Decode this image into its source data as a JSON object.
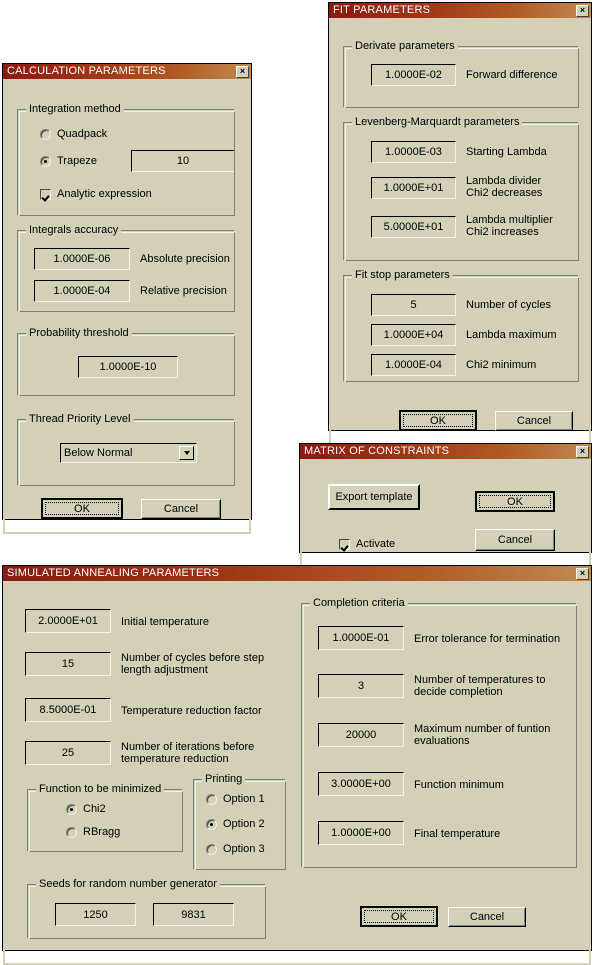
{
  "windows": {
    "calculation": {
      "title": "CALCULATION PARAMETERS",
      "close_label": "×",
      "groups": {
        "integration": {
          "caption": "Integration method",
          "radios": [
            {
              "label": "Quadpack",
              "selected": false
            },
            {
              "label": "Trapeze",
              "selected": true
            }
          ],
          "trapeze_value": "10",
          "checkbox": {
            "label": "Analytic expression",
            "checked": true
          }
        },
        "accuracy": {
          "caption": "Integrals accuracy",
          "rows": [
            {
              "value": "1.0000E-06",
              "label": "Absolute precision"
            },
            {
              "value": "1.0000E-04",
              "label": "Relative precision"
            }
          ]
        },
        "probability": {
          "caption": "Probability threshold",
          "value": "1.0000E-10"
        },
        "thread": {
          "caption": "Thread Priority Level",
          "selected": "Below Normal"
        }
      },
      "buttons": {
        "ok": "OK",
        "cancel": "Cancel"
      }
    },
    "fit": {
      "title": "FIT PARAMETERS",
      "close_label": "×",
      "groups": {
        "derivate": {
          "caption": "Derivate parameters",
          "rows": [
            {
              "value": "1.0000E-02",
              "label": "Forward difference"
            }
          ]
        },
        "levenberg": {
          "caption": "Levenberg-Marquardt parameters",
          "rows": [
            {
              "value": "1.0000E-03",
              "label": "Starting Lambda"
            },
            {
              "value": "1.0000E+01",
              "label": "Lambda divider\nChi2 decreases"
            },
            {
              "value": "5.0000E+01",
              "label": "Lambda multiplier\nChi2 increases"
            }
          ]
        },
        "fitstop": {
          "caption": "Fit stop parameters",
          "rows": [
            {
              "value": "5",
              "label": "Number of cycles"
            },
            {
              "value": "1.0000E+04",
              "label": "Lambda maximum"
            },
            {
              "value": "1.0000E-04",
              "label": "Chi2 minimum"
            }
          ]
        }
      },
      "buttons": {
        "ok": "OK",
        "cancel": "Cancel"
      }
    },
    "matrix": {
      "title": "MATRIX OF CONSTRAINTS",
      "close_label": "×",
      "export_label": "Export template",
      "activate": {
        "label": "Activate",
        "checked": true
      },
      "buttons": {
        "ok": "OK",
        "cancel": "Cancel"
      }
    },
    "annealing": {
      "title": "SIMULATED ANNEALING PARAMETERS",
      "close_label": "×",
      "left_rows": [
        {
          "value": "2.0000E+01",
          "label": "Initial temperature"
        },
        {
          "value": "15",
          "label": "Number of cycles before step\nlength adjustment"
        },
        {
          "value": "8.5000E-01",
          "label": "Temperature reduction factor"
        },
        {
          "value": "25",
          "label": "Number of iterations before\ntemperature reduction"
        }
      ],
      "minimize": {
        "caption": "Function to be minimized",
        "radios": [
          {
            "label": "Chi2",
            "selected": true
          },
          {
            "label": "RBragg",
            "selected": false
          }
        ]
      },
      "printing": {
        "caption": "Printing",
        "radios": [
          {
            "label": "Option 1",
            "selected": false
          },
          {
            "label": "Option 2",
            "selected": true
          },
          {
            "label": "Option 3",
            "selected": false
          }
        ]
      },
      "seeds": {
        "caption": "Seeds for random number generator",
        "values": [
          "1250",
          "9831"
        ]
      },
      "completion": {
        "caption": "Completion criteria",
        "rows": [
          {
            "value": "1.0000E-01",
            "label": "Error tolerance for termination"
          },
          {
            "value": "3",
            "label": "Number of temperatures to\ndecide completion"
          },
          {
            "value": "20000",
            "label": "Maximum number of funtion\nevaluations"
          },
          {
            "value": "3.0000E+00",
            "label": "Function minimum"
          },
          {
            "value": "1.0000E+00",
            "label": "Final temperature"
          }
        ]
      },
      "buttons": {
        "ok": "OK",
        "cancel": "Cancel"
      }
    }
  }
}
